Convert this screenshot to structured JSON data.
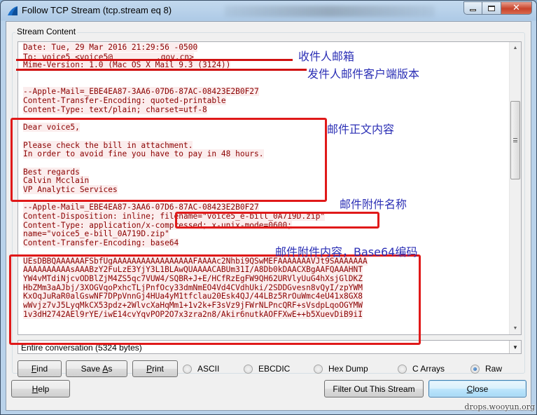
{
  "window": {
    "title": "Follow TCP Stream (tcp.stream eq 8)",
    "controls": {
      "minimize": "minimize-icon",
      "maximize": "maximize-icon",
      "close": "close-icon"
    }
  },
  "group": {
    "label": "Stream Content"
  },
  "stream": {
    "lines": [
      "Date: Tue, 29 Mar 2016 21:29:56 -0500",
      "To: voice5 <voice5@",
      "Mime-Version: 1.0 (Mac OS X Mail 9.3 (3124))",
      "",
      "",
      "--Apple-Mail=_EBE4EA87-3AA6-07D6-87AC-08423E2B0F27",
      "Content-Transfer-Encoding: quoted-printable",
      "Content-Type: text/plain; charset=utf-8",
      "",
      "Dear voice5,",
      "",
      "Please check the bill in attachment.",
      "In order to avoid fine you have to pay in 48 hours.",
      "",
      "Best regards",
      "Calvin Mcclain",
      "VP Analytic Services",
      "",
      "--Apple-Mail=_EBE4EA87-3AA6-07D6-87AC-08423E2B0F27",
      "Content-Disposition: inline; filename=\"voice5_e-bill_0A719D.zip\"",
      "Content-Type: application/x-compressed; x-unix-mode=0600;",
      "name=\"voice5_e-bill_0A719D.zip\"",
      "Content-Transfer-Encoding: base64",
      "",
      "UEsDBBQAAAAAAFSbfUgAAAAAAAAAAAAAAAAAFAAAAc2Nhbi9QSwMEFAAAAAAAVJt9SAAAAAAA",
      "AAAAAAAAAAsAAABzY2FuLzE3YjY3L1BLAwQUAAAACABUm31I/A8Db0kDAACXBgAAFQAAAHNT",
      "YW4vMTdiNjcvODBlZjM4ZS5qc7VUW4/SQBR+J+E/HCfRzEgFW9QH62URVlyUuG4hXsjGlDKZ",
      "HbZMm3aAJbj/3XOGVqoPxhcTLjPnfOcy33dmNmEO4Vd4CVdhUki/2SDDGvesn8vQyI/zpYWM",
      "KxOqJuRaR0alGswNF7DPpVnnGj4HUa4yM1tfclau20Esk4QJ/44LBz5RrOuWmc4eU41x8GX8",
      "wWvjz7vJ5LyqMkCX53pdz+2WlvcXaHqMm1+1v2k+F3sVz9jFWrNLPncQRF+sVsdpLqoOGYMW",
      "1v3dH2742AEl9rYE/iwE14cvYqvPOP2O7x3zra2n8/Akir6nutkAOFFXwE++b5XuevDiB9iI"
    ],
    "to_suffix": ".gov.cn>"
  },
  "annotations": {
    "recipient": "收件人邮箱",
    "client_version": "发件人邮件客户端版本",
    "body": "邮件正文内容",
    "attachment_name": "邮件附件名称",
    "attachment_content": "邮件附件内容，Base64编码"
  },
  "view": {
    "conversation": "Entire conversation (5324 bytes)"
  },
  "buttons": {
    "find": {
      "pre": "",
      "key": "F",
      "post": "ind"
    },
    "save_as": {
      "pre": "Save ",
      "key": "A",
      "post": "s"
    },
    "print": {
      "pre": "",
      "key": "P",
      "post": "rint"
    },
    "help": {
      "pre": "",
      "key": "H",
      "post": "elp"
    },
    "filter_out": "Filter Out This Stream",
    "close": {
      "pre": "",
      "key": "C",
      "post": "lose"
    }
  },
  "formats": {
    "options": [
      "ASCII",
      "EBCDIC",
      "Hex Dump",
      "C Arrays",
      "Raw"
    ],
    "selected": "Raw"
  },
  "watermark": "drops.wooyun.org",
  "colors": {
    "stream_text": "#8b0000",
    "stream_bg": "#fbeded",
    "annotation_red": "#e01919",
    "annotation_text": "#2b2fb5"
  }
}
